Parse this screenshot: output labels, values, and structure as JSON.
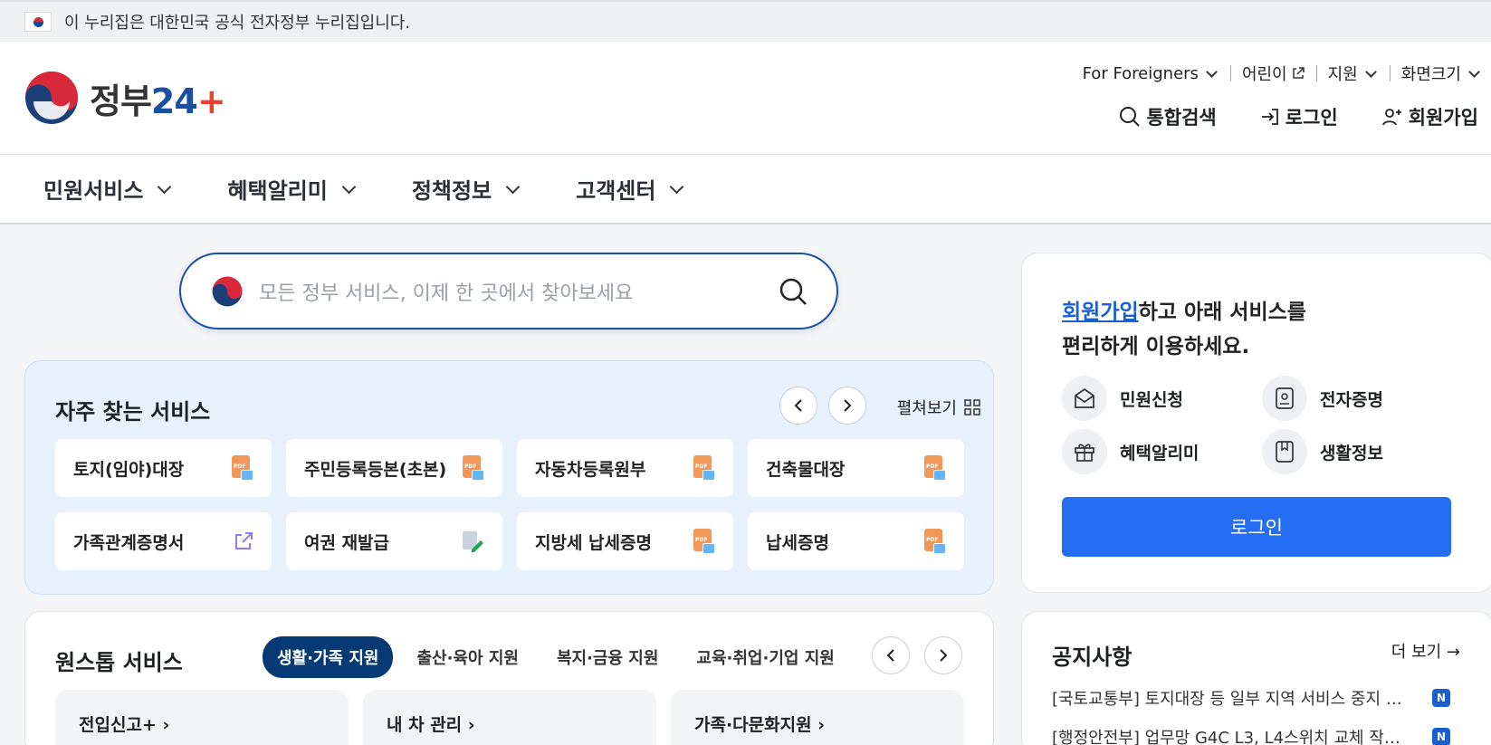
{
  "gov_banner": {
    "text": "이 누리집은 대한민국 공식 전자정부 누리집입니다."
  },
  "header": {
    "logo_text": "정부",
    "logo_num": "24",
    "logo_plus": "+",
    "util": [
      {
        "label": "For Foreigners"
      },
      {
        "label": "어린이"
      },
      {
        "label": "지원"
      },
      {
        "label": "화면크기"
      }
    ],
    "actions": {
      "search": "통합검색",
      "login": "로그인",
      "signup": "회원가입"
    }
  },
  "gnb": [
    "민원서비스",
    "혜택알리미",
    "정책정보",
    "고객센터"
  ],
  "search": {
    "placeholder": "모든 정부 서비스, 이제 한 곳에서 찾아보세요"
  },
  "frequent": {
    "title": "자주 찾는 서비스",
    "expand": "펼쳐보기",
    "items": [
      "토지(임야)대장",
      "주민등록등본(초본)",
      "자동차등록원부",
      "건축물대장",
      "가족관계증명서",
      "여권 재발급",
      "지방세 납세증명",
      "납세증명"
    ]
  },
  "onestop": {
    "title": "원스톱 서비스",
    "tabs": [
      "생활·가족 지원",
      "출산·육아 지원",
      "복지·금융 지원",
      "교육·취업·기업 지원"
    ],
    "cards": [
      "전입신고+",
      "내 차 관리",
      "가족·다문화지원"
    ]
  },
  "login_panel": {
    "msg_link": "회원가입",
    "msg_rest": "하고 아래 서비스를",
    "msg_line2": "편리하게 이용하세요.",
    "services": [
      "민원신청",
      "전자증명",
      "혜택알리미",
      "생활정보"
    ],
    "button": "로그인"
  },
  "notice": {
    "title": "공지사항",
    "more": "더 보기 →",
    "items": [
      {
        "text": "[국토교통부] 토지대장 등 일부 지역 서비스 중지 …",
        "badge": "N"
      },
      {
        "text": "[행정안전부] 업무망 G4C L3, L4스위치 교체 작…",
        "badge": "N"
      }
    ]
  },
  "colors": {
    "primary": "#256ef4",
    "navy": "#063a74",
    "freq_bg": "#e6f1fc"
  }
}
